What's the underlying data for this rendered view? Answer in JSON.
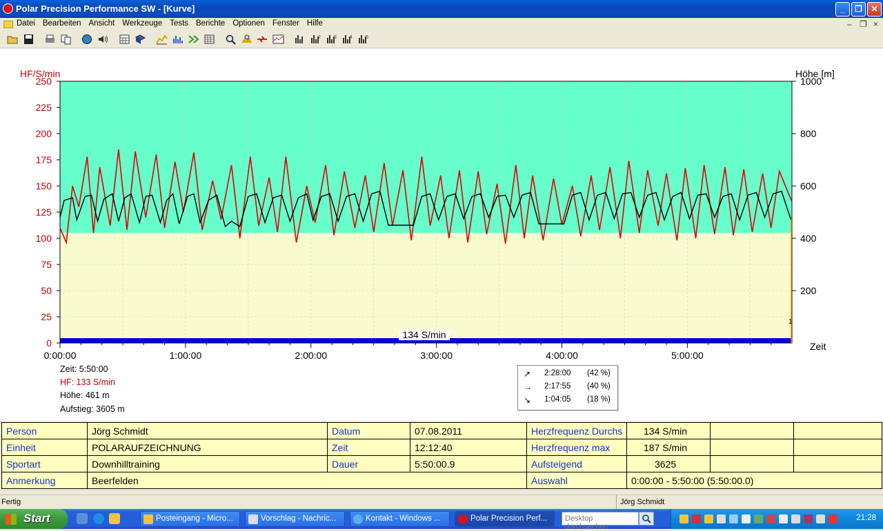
{
  "window": {
    "title": "Polar Precision Performance SW - [Kurve]",
    "minimize_glyph": "_",
    "restore_glyph": "❐",
    "close_glyph": "✕"
  },
  "menu": {
    "items": [
      "Datei",
      "Bearbeiten",
      "Ansicht",
      "Werkzeuge",
      "Tests",
      "Berichte",
      "Optionen",
      "Fenster",
      "Hilfe"
    ],
    "mdi_min": "–",
    "mdi_restore": "❐",
    "mdi_close": "×"
  },
  "toolbar": {
    "icons": [
      "open-icon",
      "save-icon",
      "print-icon",
      "copy-icon",
      "globe-icon",
      "sound-icon",
      "calendar-icon",
      "book-icon",
      "curve-icon",
      "bar-chart-icon",
      "compare-icon",
      "table-icon",
      "zoom-icon",
      "hf-icon",
      "transfer-icon",
      "graph-icon",
      "chart1-icon",
      "chart2-icon",
      "chart3-icon",
      "chart4-icon",
      "chart5-icon"
    ]
  },
  "chart_data": {
    "type": "line",
    "y_left_label": "HF/S/min",
    "y_right_label": "Höhe [m]",
    "x_label": "Zeit",
    "y_left_ticks": [
      "250",
      "225",
      "200",
      "175",
      "150",
      "125",
      "100",
      "75",
      "50",
      "25",
      "0"
    ],
    "y_right_ticks": [
      "1000",
      "800",
      "600",
      "400",
      "200"
    ],
    "x_ticks": [
      "0:00:00",
      "1:00:00",
      "2:00:00",
      "3:00:00",
      "4:00:00",
      "5:00:00"
    ],
    "ylim_left": [
      0,
      250
    ],
    "ylim_right": [
      0,
      1000
    ],
    "xlim_minutes": [
      0,
      350
    ],
    "average_label": "134 S/min",
    "end_marker": "1",
    "zone_colors": {
      "upper": "#66ffcc",
      "lower": "#f9fbce"
    },
    "zone_boundary_hf": 105,
    "hf_color": "#e00000",
    "altitude_color": "#000000",
    "hf_series": {
      "name": "HF",
      "x_minutes": [
        0,
        3,
        6,
        9,
        13,
        16,
        19,
        24,
        28,
        32,
        36,
        41,
        46,
        50,
        55,
        59,
        64,
        68,
        73,
        77,
        82,
        86,
        91,
        95,
        100,
        104,
        108,
        113,
        118,
        122,
        127,
        131,
        136,
        141,
        146,
        150,
        155,
        159,
        164,
        168,
        173,
        177,
        182,
        186,
        191,
        195,
        200,
        204,
        209,
        213,
        218,
        222,
        226,
        231,
        236,
        240,
        245,
        249,
        254,
        258,
        263,
        268,
        272,
        277,
        281,
        286,
        290,
        295,
        299,
        304,
        308,
        313,
        318,
        322,
        327,
        331,
        336,
        340,
        344,
        350
      ],
      "values": [
        110,
        96,
        150,
        130,
        178,
        105,
        168,
        112,
        185,
        108,
        183,
        120,
        180,
        110,
        173,
        125,
        182,
        108,
        155,
        118,
        170,
        100,
        178,
        112,
        158,
        106,
        178,
        96,
        150,
        115,
        170,
        103,
        164,
        110,
        160,
        106,
        172,
        112,
        165,
        98,
        178,
        112,
        160,
        100,
        165,
        96,
        164,
        104,
        152,
        95,
        170,
        100,
        160,
        98,
        157,
        113,
        150,
        102,
        160,
        108,
        168,
        100,
        174,
        105,
        165,
        112,
        162,
        98,
        167,
        100,
        170,
        104,
        168,
        103,
        166,
        106,
        162,
        110,
        164,
        135
      ]
    },
    "altitude_series": {
      "name": "Höhe",
      "x_minutes": [
        0,
        2,
        6,
        8,
        12,
        15,
        18,
        21,
        25,
        28,
        31,
        34,
        38,
        41,
        44,
        48,
        51,
        54,
        57,
        61,
        64,
        67,
        71,
        75,
        79,
        82,
        86,
        90,
        94,
        98,
        102,
        106,
        110,
        114,
        118,
        121,
        125,
        129,
        133,
        137,
        141,
        145,
        149,
        153,
        157,
        161,
        165,
        169,
        173,
        177,
        181,
        185,
        189,
        193,
        197,
        201,
        205,
        209,
        213,
        217,
        221,
        225,
        229,
        233,
        237,
        241,
        245,
        249,
        253,
        257,
        261,
        265,
        269,
        273,
        277,
        281,
        285,
        289,
        293,
        297,
        301,
        305,
        309,
        313,
        317,
        321,
        325,
        329,
        333,
        337,
        341,
        345,
        350
      ],
      "values": [
        480,
        545,
        555,
        470,
        560,
        565,
        465,
        550,
        570,
        465,
        555,
        570,
        460,
        560,
        565,
        460,
        545,
        570,
        455,
        560,
        570,
        460,
        545,
        565,
        445,
        465,
        445,
        560,
        570,
        460,
        555,
        565,
        465,
        555,
        570,
        470,
        560,
        570,
        465,
        560,
        570,
        465,
        570,
        580,
        450,
        450,
        450,
        450,
        560,
        570,
        470,
        560,
        570,
        475,
        560,
        570,
        480,
        560,
        565,
        480,
        565,
        575,
        455,
        455,
        455,
        455,
        565,
        575,
        470,
        565,
        575,
        475,
        570,
        575,
        480,
        565,
        575,
        470,
        560,
        575,
        475,
        565,
        570,
        480,
        560,
        570,
        470,
        565,
        575,
        480,
        570,
        580,
        460
      ]
    }
  },
  "cursor_info": {
    "zeit": "Zeit: 5:50:00",
    "hf": "HF: 133 S/min",
    "hoehe": "Höhe: 461 m",
    "aufstieg": "Aufstieg: 3605 m"
  },
  "stats_box": {
    "rows": [
      {
        "arrow": "↗",
        "time": "2:28:00",
        "pct": "(42 %)"
      },
      {
        "arrow": "→",
        "time": "2:17:55",
        "pct": "(40 %)"
      },
      {
        "arrow": "↘",
        "time": "1:04:05",
        "pct": "(18 %)"
      }
    ]
  },
  "info_table": {
    "person_label": "Person",
    "person": "Jörg Schmidt",
    "einheit_label": "Einheit",
    "einheit": "POLARAUFZEICHNUNG",
    "sportart_label": "Sportart",
    "sportart": "Downhilltraining",
    "anmerkung_label": "Anmerkung",
    "anmerkung": "Beerfelden",
    "datum_label": "Datum",
    "datum": "07.08.2011",
    "zeit_label": "Zeit",
    "zeit": "12:12:40",
    "dauer_label": "Dauer",
    "dauer": "5:50:00.9",
    "hf_avg_label": "Herzfrequenz Durchs",
    "hf_avg": "134 S/min",
    "hf_max_label": "Herzfrequenz max",
    "hf_max": "187 S/min",
    "aufsteigend_label": "Aufsteigend",
    "aufsteigend": "3625",
    "auswahl_label": "Auswahl",
    "auswahl": "0:00:00 - 5:50:00 (5:50:00.0)"
  },
  "statusbar": {
    "left": "Fertig",
    "right": "Jörg Schmidt"
  },
  "taskbar": {
    "start": "Start",
    "tasks": [
      {
        "label": "Posteingang - Micro...",
        "icon": "outlook-icon",
        "active": false
      },
      {
        "label": "Vorschlag - Nachric...",
        "icon": "mail-icon",
        "active": false
      },
      {
        "label": "Kontakt - Windows ...",
        "icon": "ie-icon",
        "active": false
      },
      {
        "label": "Polar Precision Perf...",
        "icon": "polar-icon",
        "active": true
      }
    ],
    "search_placeholder": "Desktop durchsuchen",
    "clock": "21:28"
  }
}
